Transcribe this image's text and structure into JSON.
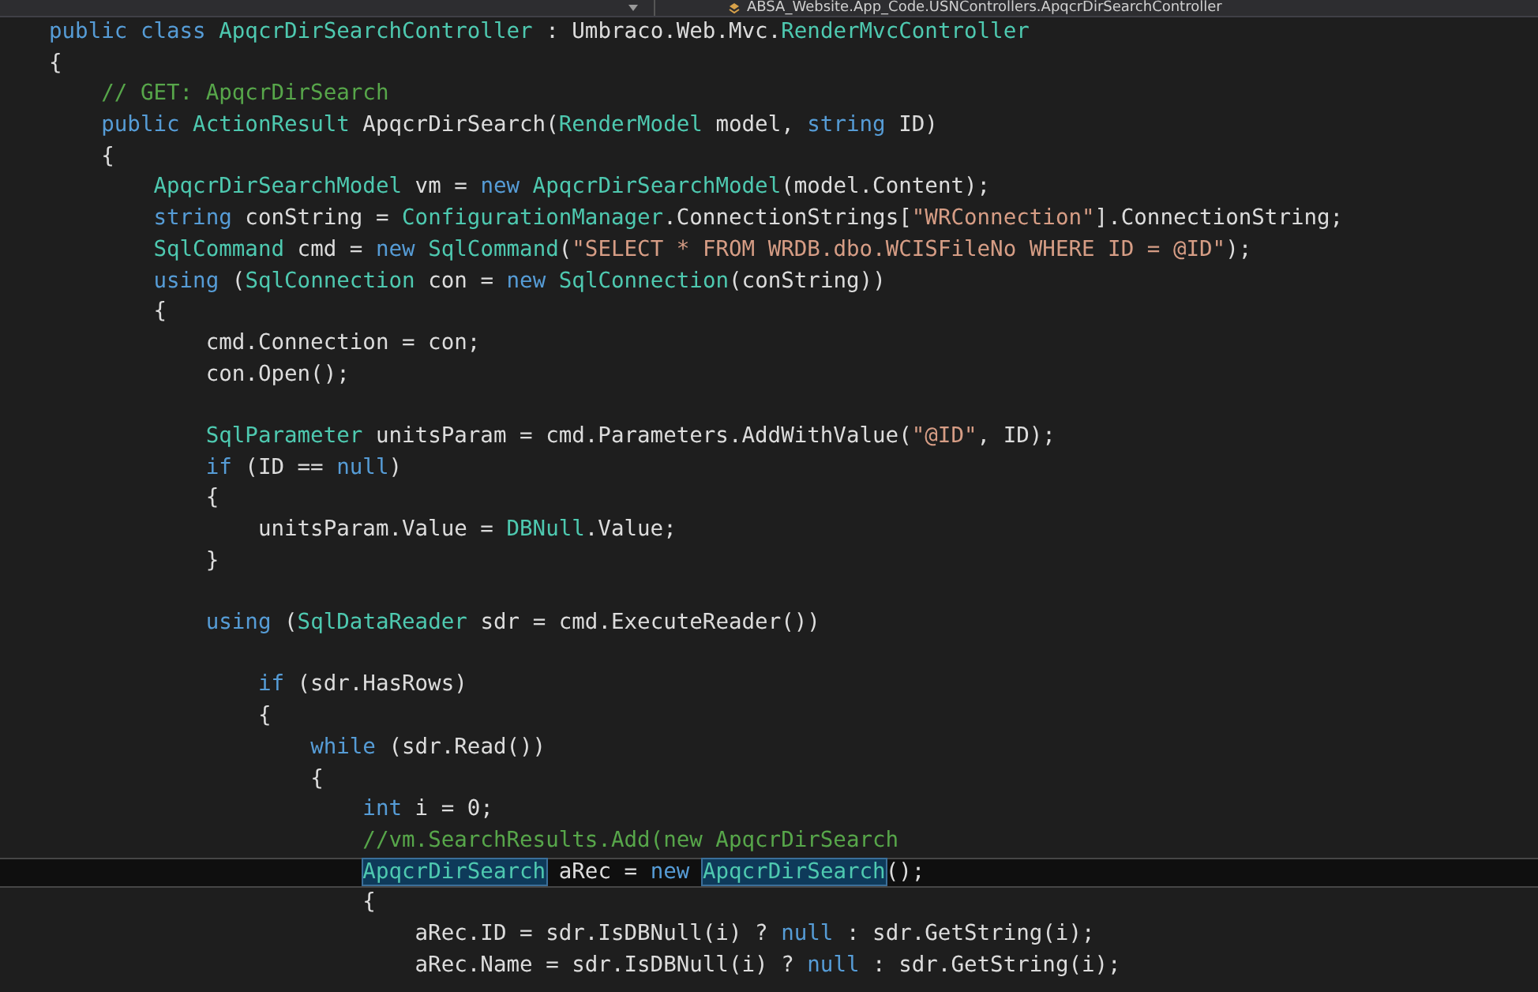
{
  "navigation_bar": {
    "path": "ABSA_Website.App_Code.USNControllers.ApqcrDirSearchController"
  },
  "editor": {
    "lines": [
      {
        "kind": "code",
        "current": false,
        "tokens": [
          {
            "kind": "keyword",
            "text": "public class"
          },
          {
            "kind": "type",
            "text": " ApqcrDirSearchController"
          },
          {
            "kind": "plain",
            "text": " : Umbraco.Web.Mvc."
          },
          {
            "kind": "type",
            "text": "RenderMvcController"
          }
        ]
      },
      {
        "kind": "code",
        "current": false,
        "tokens": [
          {
            "kind": "plain",
            "text": "{"
          }
        ]
      },
      {
        "kind": "code",
        "current": false,
        "tokens": [
          {
            "kind": "comment",
            "text": "    // GET: ApqcrDirSearch"
          }
        ]
      },
      {
        "kind": "code",
        "current": false,
        "tokens": [
          {
            "kind": "keyword",
            "text": "    public"
          },
          {
            "kind": "type",
            "text": " ActionResult"
          },
          {
            "kind": "plain",
            "text": " ApqcrDirSearch("
          },
          {
            "kind": "type",
            "text": "RenderModel"
          },
          {
            "kind": "plain",
            "text": " model, "
          },
          {
            "kind": "keyword",
            "text": "string"
          },
          {
            "kind": "plain",
            "text": " ID)"
          }
        ]
      },
      {
        "kind": "code",
        "current": false,
        "tokens": [
          {
            "kind": "plain",
            "text": "    {"
          }
        ]
      },
      {
        "kind": "code",
        "current": false,
        "tokens": [
          {
            "kind": "type",
            "text": "        ApqcrDirSearchModel"
          },
          {
            "kind": "plain",
            "text": " vm = "
          },
          {
            "kind": "keyword",
            "text": "new"
          },
          {
            "kind": "type",
            "text": " ApqcrDirSearchModel"
          },
          {
            "kind": "plain",
            "text": "(model.Content);"
          }
        ]
      },
      {
        "kind": "code",
        "current": false,
        "tokens": [
          {
            "kind": "keyword",
            "text": "        string"
          },
          {
            "kind": "plain",
            "text": " conString = "
          },
          {
            "kind": "type",
            "text": "ConfigurationManager"
          },
          {
            "kind": "plain",
            "text": ".ConnectionStrings["
          },
          {
            "kind": "string",
            "text": "\"WRConnection\""
          },
          {
            "kind": "plain",
            "text": "].ConnectionString;"
          }
        ]
      },
      {
        "kind": "code",
        "current": false,
        "tokens": [
          {
            "kind": "type",
            "text": "        SqlCommand"
          },
          {
            "kind": "plain",
            "text": " cmd = "
          },
          {
            "kind": "keyword",
            "text": "new"
          },
          {
            "kind": "type",
            "text": " SqlCommand"
          },
          {
            "kind": "plain",
            "text": "("
          },
          {
            "kind": "string",
            "text": "\"SELECT * FROM WRDB.dbo.WCISFileNo WHERE ID = @ID\""
          },
          {
            "kind": "plain",
            "text": ");"
          }
        ]
      },
      {
        "kind": "code",
        "current": false,
        "tokens": [
          {
            "kind": "keyword",
            "text": "        using"
          },
          {
            "kind": "plain",
            "text": " ("
          },
          {
            "kind": "type",
            "text": "SqlConnection"
          },
          {
            "kind": "plain",
            "text": " con = "
          },
          {
            "kind": "keyword",
            "text": "new"
          },
          {
            "kind": "type",
            "text": " SqlConnection"
          },
          {
            "kind": "plain",
            "text": "(conString))"
          }
        ]
      },
      {
        "kind": "code",
        "current": false,
        "tokens": [
          {
            "kind": "plain",
            "text": "        {"
          }
        ]
      },
      {
        "kind": "code",
        "current": false,
        "tokens": [
          {
            "kind": "plain",
            "text": "            cmd.Connection = con;"
          }
        ]
      },
      {
        "kind": "code",
        "current": false,
        "tokens": [
          {
            "kind": "plain",
            "text": "            con.Open();"
          }
        ]
      },
      {
        "kind": "blank",
        "current": false
      },
      {
        "kind": "code",
        "current": false,
        "tokens": [
          {
            "kind": "type",
            "text": "            SqlParameter"
          },
          {
            "kind": "plain",
            "text": " unitsParam = cmd.Parameters.AddWithValue("
          },
          {
            "kind": "string",
            "text": "\"@ID\""
          },
          {
            "kind": "plain",
            "text": ", ID);"
          }
        ]
      },
      {
        "kind": "code",
        "current": false,
        "tokens": [
          {
            "kind": "keyword",
            "text": "            if"
          },
          {
            "kind": "plain",
            "text": " (ID == "
          },
          {
            "kind": "keyword",
            "text": "null"
          },
          {
            "kind": "plain",
            "text": ")"
          }
        ]
      },
      {
        "kind": "code",
        "current": false,
        "tokens": [
          {
            "kind": "plain",
            "text": "            {"
          }
        ]
      },
      {
        "kind": "code",
        "current": false,
        "tokens": [
          {
            "kind": "plain",
            "text": "                unitsParam.Value = "
          },
          {
            "kind": "type",
            "text": "DBNull"
          },
          {
            "kind": "plain",
            "text": ".Value;"
          }
        ]
      },
      {
        "kind": "code",
        "current": false,
        "tokens": [
          {
            "kind": "plain",
            "text": "            }"
          }
        ]
      },
      {
        "kind": "blank",
        "current": false
      },
      {
        "kind": "code",
        "current": false,
        "tokens": [
          {
            "kind": "keyword",
            "text": "            using"
          },
          {
            "kind": "plain",
            "text": " ("
          },
          {
            "kind": "type",
            "text": "SqlDataReader"
          },
          {
            "kind": "plain",
            "text": " sdr = cmd.ExecuteReader())"
          }
        ]
      },
      {
        "kind": "blank",
        "current": false
      },
      {
        "kind": "code",
        "current": false,
        "tokens": [
          {
            "kind": "keyword",
            "text": "                if"
          },
          {
            "kind": "plain",
            "text": " (sdr.HasRows)"
          }
        ]
      },
      {
        "kind": "code",
        "current": false,
        "tokens": [
          {
            "kind": "plain",
            "text": "                {"
          }
        ]
      },
      {
        "kind": "code",
        "current": false,
        "tokens": [
          {
            "kind": "keyword",
            "text": "                    while"
          },
          {
            "kind": "plain",
            "text": " (sdr.Read())"
          }
        ]
      },
      {
        "kind": "code",
        "current": false,
        "tokens": [
          {
            "kind": "plain",
            "text": "                    {"
          }
        ]
      },
      {
        "kind": "code",
        "current": false,
        "tokens": [
          {
            "kind": "keyword",
            "text": "                        int"
          },
          {
            "kind": "plain",
            "text": " i = 0;"
          }
        ]
      },
      {
        "kind": "code",
        "current": false,
        "tokens": [
          {
            "kind": "comment",
            "text": "                        //vm.SearchResults.Add(new ApqcrDirSearch"
          }
        ]
      },
      {
        "kind": "code",
        "current": true,
        "tokens": [
          {
            "kind": "reference",
            "text": "                        ApqcrDirSearch"
          },
          {
            "kind": "plain",
            "text": " aRec = "
          },
          {
            "kind": "keyword",
            "text": "new "
          },
          {
            "kind": "reference",
            "text": "ApqcrDirSearch"
          },
          {
            "kind": "plain",
            "text": "();"
          }
        ]
      },
      {
        "kind": "code",
        "current": false,
        "tokens": [
          {
            "kind": "plain",
            "text": "                        {"
          }
        ]
      },
      {
        "kind": "code",
        "current": false,
        "tokens": [
          {
            "kind": "plain",
            "text": "                            aRec.ID = sdr.IsDBNull(i) ? "
          },
          {
            "kind": "keyword",
            "text": "null"
          },
          {
            "kind": "plain",
            "text": " : sdr.GetString(i);"
          }
        ]
      },
      {
        "kind": "code",
        "current": false,
        "tokens": [
          {
            "kind": "plain",
            "text": "                            aRec.Name = sdr.IsDBNull(i) ? "
          },
          {
            "kind": "keyword",
            "text": "null"
          },
          {
            "kind": "plain",
            "text": " : sdr.GetString(i);"
          }
        ]
      }
    ]
  }
}
